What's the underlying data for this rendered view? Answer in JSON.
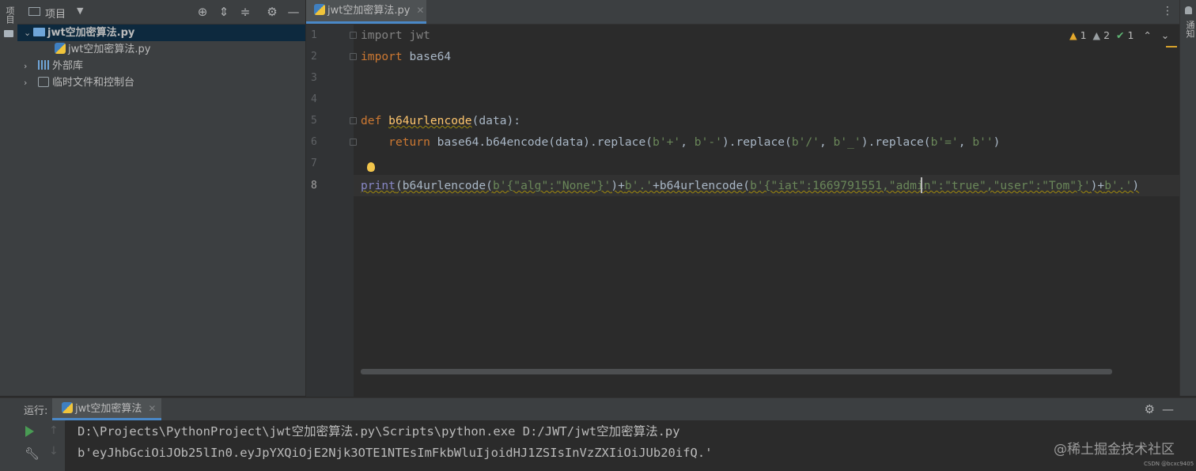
{
  "left_strip": {
    "project_tab_label": "项目"
  },
  "project_panel": {
    "title": "项目",
    "tree": [
      {
        "label": "jwt空加密算法.py",
        "icon": "python-folder-icon",
        "expanded": true,
        "selected": true
      },
      {
        "label": "jwt空加密算法.py",
        "icon": "python-file-icon"
      },
      {
        "label": "外部库",
        "icon": "library-icon",
        "expanded": false
      },
      {
        "label": "临时文件和控制台",
        "icon": "scratch-icon",
        "expanded": false
      }
    ]
  },
  "editor": {
    "tab_label": "jwt空加密算法.py",
    "line_numbers": [
      "1",
      "2",
      "3",
      "4",
      "5",
      "6",
      "7",
      "8"
    ],
    "inspections": {
      "warnings": "1",
      "weak_warnings": "2",
      "ok": "1"
    }
  },
  "right_strip": {
    "notifications_label": "通知"
  },
  "run_panel": {
    "label": "运行:",
    "tab_label": "jwt空加密算法",
    "console": [
      "D:\\Projects\\PythonProject\\jwt空加密算法.py\\Scripts\\python.exe D:/JWT/jwt空加密算法.py",
      "b'eyJhbGciOiJOb25lIn0.eyJpYXQiOjE2Njk3OTE1NTEsImFkbWluIjoidHJ1ZSIsInVzZXIiOiJUb20ifQ.'"
    ]
  },
  "watermark": {
    "text": "@稀土掘金技术社区",
    "sub": "CSDN @bcxc9405"
  },
  "colors": {
    "keyword": "#cc7832",
    "function": "#ffc66d",
    "string": "#6a8759",
    "number": "#6897bb",
    "accent": "#4a88c7"
  }
}
